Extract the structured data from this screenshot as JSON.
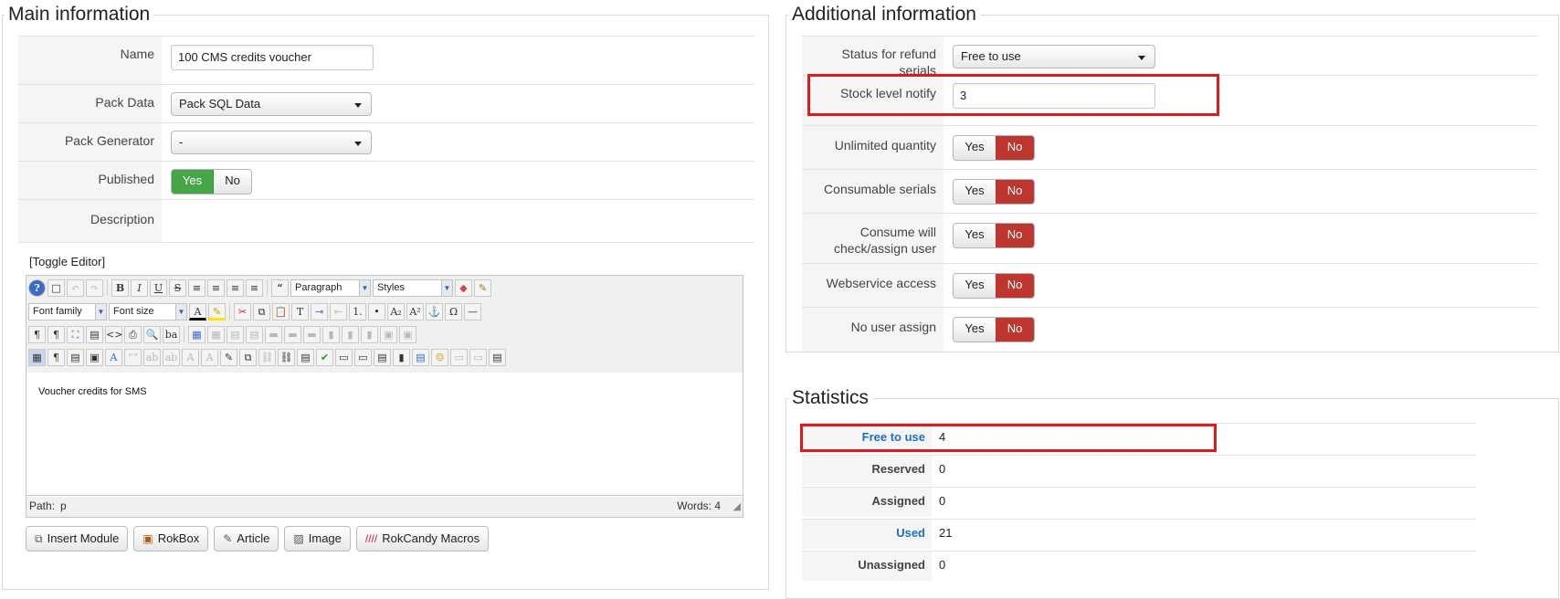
{
  "main": {
    "legend": "Main information",
    "name": {
      "label": "Name",
      "value": "100 CMS credits voucher"
    },
    "pack_data": {
      "label": "Pack Data",
      "value": "Pack SQL Data"
    },
    "pack_generator": {
      "label": "Pack Generator",
      "value": "-"
    },
    "published": {
      "label": "Published",
      "yes": "Yes",
      "no": "No",
      "selected": "Yes"
    },
    "description": {
      "label": "Description"
    },
    "toggle_editor": "[Toggle Editor]",
    "editor": {
      "paragraph": "Paragraph",
      "styles": "Styles",
      "font_family": "Font family",
      "font_size": "Font size",
      "content": "Voucher credits for SMS",
      "path_label": "Path:",
      "path_value": "p",
      "words": "Words: 4"
    },
    "buttons": {
      "insert_module": "Insert Module",
      "rokbox": "RokBox",
      "article": "Article",
      "image": "Image",
      "rokcandy": "RokCandy Macros"
    }
  },
  "additional": {
    "legend": "Additional information",
    "status_refund": {
      "label": "Status for refund serials",
      "value": "Free to use"
    },
    "stock_level": {
      "label": "Stock level notify",
      "value": "3"
    },
    "unlimited_quantity": {
      "label": "Unlimited quantity",
      "yes": "Yes",
      "no": "No",
      "selected": "No"
    },
    "consumable_serials": {
      "label": "Consumable serials",
      "yes": "Yes",
      "no": "No",
      "selected": "No"
    },
    "consume_check": {
      "label_line1": "Consume will",
      "label_line2": "check/assign user",
      "yes": "Yes",
      "no": "No",
      "selected": "No"
    },
    "webservice_access": {
      "label": "Webservice access",
      "yes": "Yes",
      "no": "No",
      "selected": "No"
    },
    "no_user_assign": {
      "label": "No user assign",
      "yes": "Yes",
      "no": "No",
      "selected": "No"
    }
  },
  "statistics": {
    "legend": "Statistics",
    "free_to_use": {
      "label": "Free to use",
      "value": "4"
    },
    "reserved": {
      "label": "Reserved",
      "value": "0"
    },
    "assigned": {
      "label": "Assigned",
      "value": "0"
    },
    "used": {
      "label": "Used",
      "value": "21"
    },
    "unassigned": {
      "label": "Unassigned",
      "value": "0"
    }
  },
  "colors": {
    "highlight_border": "#dd1b1b",
    "toggle_yes": "#46a546",
    "toggle_no": "#bd362f",
    "link": "#1f6fbf"
  }
}
